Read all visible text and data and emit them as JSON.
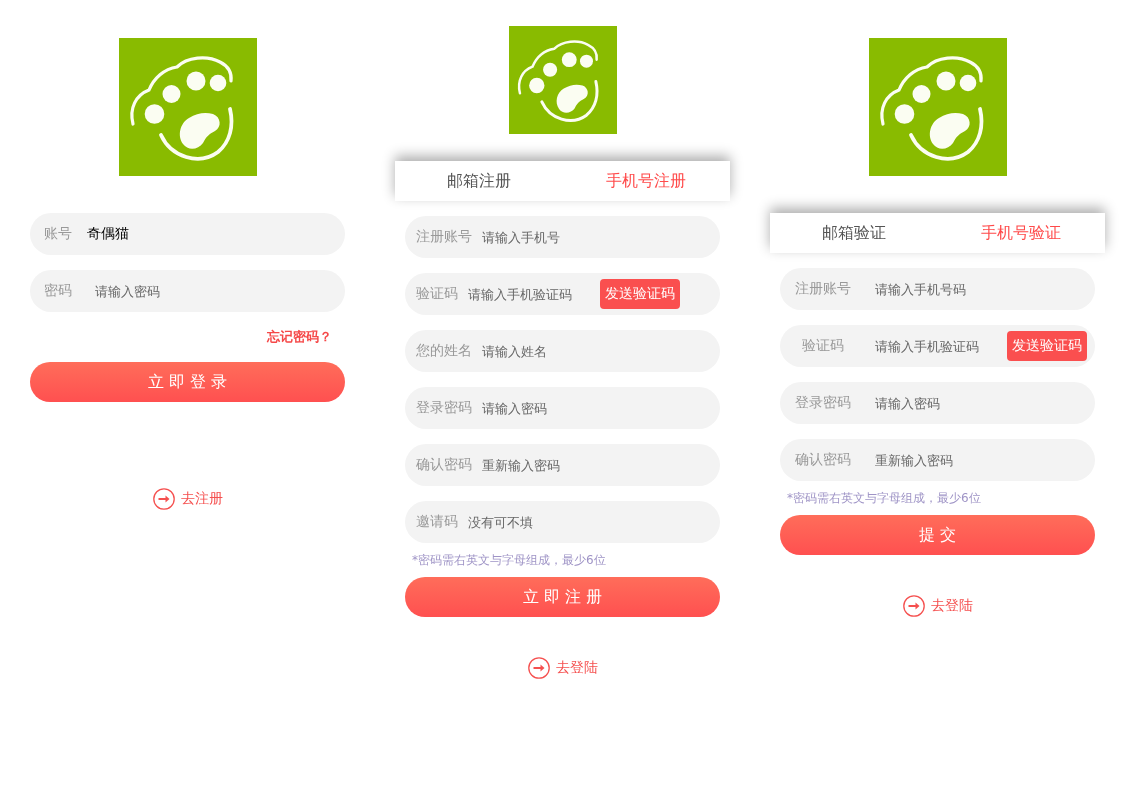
{
  "panels": [
    {
      "kind": "login",
      "fields": [
        {
          "label": "账号",
          "value": "奇偶猫"
        },
        {
          "label": "密码",
          "placeholder": "请输入密码"
        }
      ],
      "forgot_link": "忘记密码？",
      "submit_button": "立即登录",
      "switch_link": "去注册"
    },
    {
      "kind": "register",
      "tabs": [
        {
          "label": "邮箱注册",
          "selected": false
        },
        {
          "label": "手机号注册",
          "selected": true
        }
      ],
      "fields": [
        {
          "label": "注册账号",
          "placeholder": "请输入手机号"
        },
        {
          "label": "验证码",
          "placeholder": "请输入手机验证码",
          "action_button": "发送验证码"
        },
        {
          "label": "您的姓名",
          "placeholder": "请输入姓名"
        },
        {
          "label": "登录密码",
          "placeholder": "请输入密码"
        },
        {
          "label": "确认密码",
          "placeholder": "重新输入密码"
        },
        {
          "label": "邀请码",
          "placeholder": "没有可不填"
        }
      ],
      "hint": "*密码需右英文与字母组成，最少6位",
      "submit_button": "立即注册",
      "switch_link": "去登陆"
    },
    {
      "kind": "verify",
      "tabs": [
        {
          "label": "邮箱验证",
          "selected": false
        },
        {
          "label": "手机号验证",
          "selected": true
        }
      ],
      "fields": [
        {
          "label": "注册账号",
          "placeholder": "请输入手机号码"
        },
        {
          "label": "验证码",
          "placeholder": "请输入手机验证码",
          "action_button": "发送验证码"
        },
        {
          "label": "登录密码",
          "placeholder": "请输入密码"
        },
        {
          "label": "确认密码",
          "placeholder": "重新输入密码"
        }
      ],
      "hint": "*密码需右英文与字母组成，最少6位",
      "submit_button": "提交",
      "switch_link": "去登陆"
    }
  ]
}
